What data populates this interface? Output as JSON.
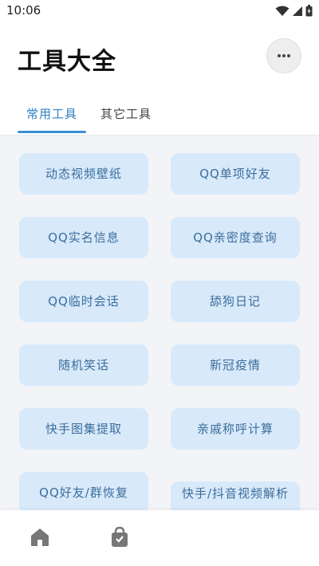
{
  "status_bar": {
    "time": "10:06"
  },
  "header": {
    "title": "工具大全"
  },
  "tabs": [
    {
      "label": "常用工具",
      "active": true
    },
    {
      "label": "其它工具",
      "active": false
    }
  ],
  "tools": [
    "动态视频壁纸",
    "QQ单项好友",
    "QQ实名信息",
    "QQ亲密度查询",
    "QQ临时会话",
    "舔狗日记",
    "随机笑话",
    "新冠疫情",
    "快手图集提取",
    "亲戚称呼计算",
    "QQ好友/群恢复",
    "快手/抖音视频解析"
  ],
  "bottom_nav": [
    {
      "icon": "home-icon"
    },
    {
      "icon": "shopping-bag-icon"
    }
  ],
  "colors": {
    "accent": "#3b8fd6",
    "tile_background": "#d8e9fa",
    "tile_text": "#3a6e9c",
    "content_background": "#f2f4f7"
  }
}
